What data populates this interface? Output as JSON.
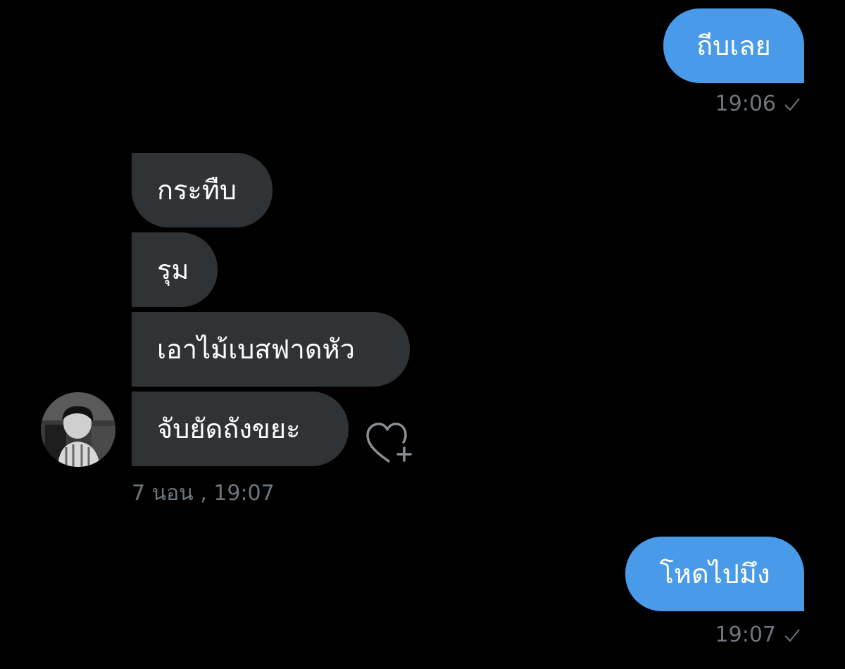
{
  "messages": {
    "out_1": {
      "text": "ถีบเลย",
      "time": "19:06"
    },
    "in_group": {
      "items": [
        "กระทืบ",
        "รุม",
        "เอาไม้เบสฟาดหัว",
        "จับยัดถังขยะ"
      ],
      "timestamp": "7 นอน  , 19:07"
    },
    "out_2": {
      "text": "โหดไปมึง",
      "time": "19:07"
    }
  },
  "icons": {
    "read_status": "check-icon",
    "reaction": "heart-plus-icon",
    "avatar": "avatar-photo"
  },
  "colors": {
    "background": "#000000",
    "outgoing_bubble": "#4a9aea",
    "incoming_bubble": "#2f3336",
    "meta_text": "#6e767d",
    "bubble_text": "#ffffff"
  }
}
